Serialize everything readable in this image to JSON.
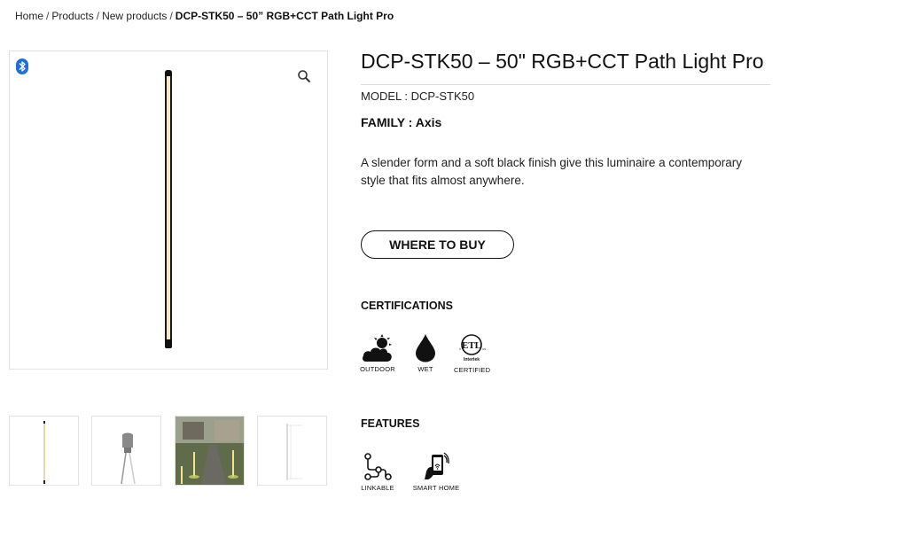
{
  "breadcrumb": {
    "items": [
      "Home",
      "Products",
      "New products"
    ],
    "current": "DCP-STK50 – 50” RGB+CCT Path Light Pro"
  },
  "product": {
    "title": "DCP-STK50 – 50\" RGB+CCT Path Light Pro",
    "model": "MODEL : DCP-STK50",
    "family": "FAMILY : Axis",
    "description": "A slender form and a soft black finish give this luminaire a contemporary style that fits almost anywhere."
  },
  "actions": {
    "where_to_buy": "WHERE TO BUY"
  },
  "certifications": {
    "heading": "CERTIFICATIONS",
    "items": [
      {
        "label": "OUTDOOR",
        "icon": "outdoor-weather-icon"
      },
      {
        "label": "WET",
        "icon": "water-drop-icon"
      },
      {
        "label": "CERTIFIED",
        "icon": "etl-intertek-icon",
        "logo_text": "Intertek"
      }
    ]
  },
  "features": {
    "heading": "FEATURES",
    "items": [
      {
        "label": "LINKABLE",
        "icon": "linkable-icon"
      },
      {
        "label": "SMART HOME",
        "icon": "smart-home-phone-icon"
      }
    ]
  },
  "gallery": {
    "badge_icon": "bluetooth-icon",
    "zoom_icon": "magnifier-icon",
    "thumbnails": 4
  },
  "colors": {
    "accent_blue": "#1e6fd9",
    "text": "#111111",
    "border": "#e2e2e2"
  }
}
